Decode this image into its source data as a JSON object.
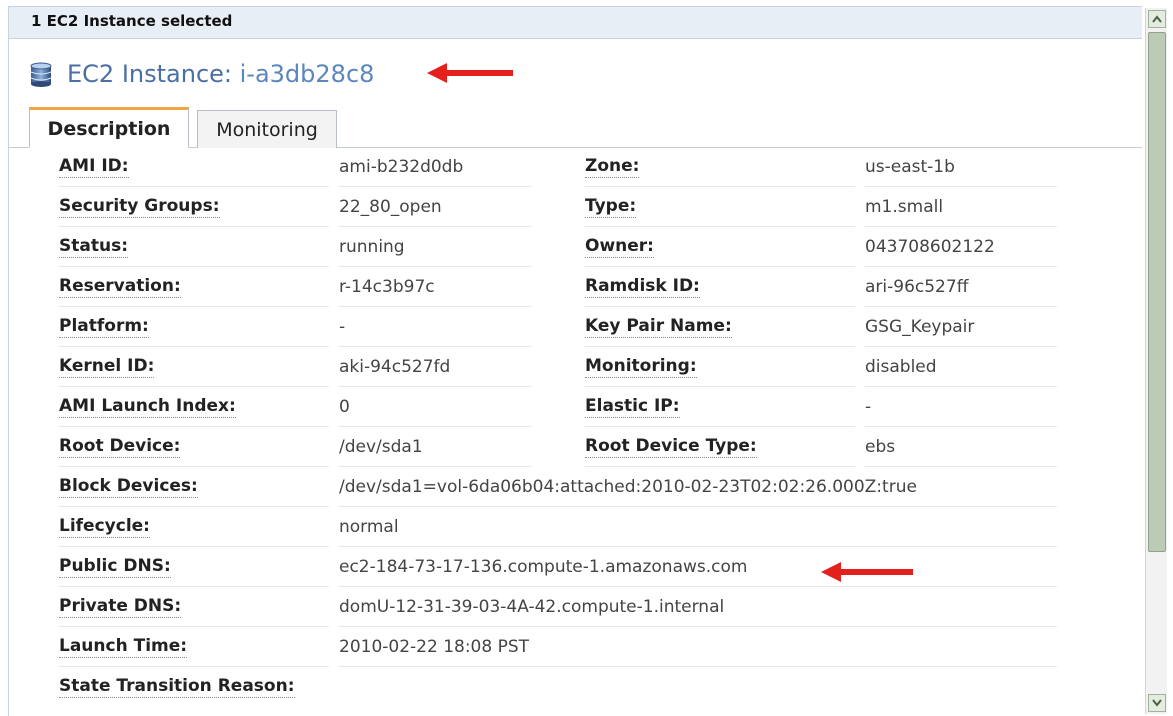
{
  "selection_bar": {
    "text": "1 EC2 Instance selected"
  },
  "heading": {
    "prefix": "EC2 Instance: ",
    "instance_id": "i-a3db28c8",
    "icon": "database-icon"
  },
  "tabs": [
    {
      "label": "Description",
      "active": true
    },
    {
      "label": "Monitoring",
      "active": false
    }
  ],
  "details": {
    "left": [
      {
        "label": "AMI ID:",
        "value": "ami-b232d0db"
      },
      {
        "label": "Security Groups:",
        "value": "22_80_open"
      },
      {
        "label": "Status:",
        "value": "running"
      },
      {
        "label": "Reservation:",
        "value": "r-14c3b97c"
      },
      {
        "label": "Platform:",
        "value": "-"
      },
      {
        "label": "Kernel ID:",
        "value": "aki-94c527fd"
      },
      {
        "label": "AMI Launch Index:",
        "value": "0"
      },
      {
        "label": "Root Device:",
        "value": "/dev/sda1"
      },
      {
        "label": "Block Devices:",
        "value": "/dev/sda1=vol-6da06b04:attached:2010-02-23T02:02:26.000Z:true"
      },
      {
        "label": "Lifecycle:",
        "value": "normal"
      },
      {
        "label": "Public DNS:",
        "value": "ec2-184-73-17-136.compute-1.amazonaws.com"
      },
      {
        "label": "Private DNS:",
        "value": "domU-12-31-39-03-4A-42.compute-1.internal"
      },
      {
        "label": "Launch Time:",
        "value": "2010-02-22 18:08 PST"
      },
      {
        "label": "State Transition Reason:",
        "value": ""
      }
    ],
    "right": [
      {
        "label": "Zone:",
        "value": "us-east-1b"
      },
      {
        "label": "Type:",
        "value": "m1.small"
      },
      {
        "label": "Owner:",
        "value": "043708602122"
      },
      {
        "label": "Ramdisk ID:",
        "value": "ari-96c527ff"
      },
      {
        "label": "Key Pair Name:",
        "value": "GSG_Keypair"
      },
      {
        "label": "Monitoring:",
        "value": "disabled"
      },
      {
        "label": "Elastic IP:",
        "value": "-"
      },
      {
        "label": "Root Device Type:",
        "value": "ebs"
      }
    ]
  },
  "colors": {
    "accent_arrow": "#e3201b",
    "heading_link": "#4a6fa5",
    "tab_highlight": "#f0a742"
  }
}
